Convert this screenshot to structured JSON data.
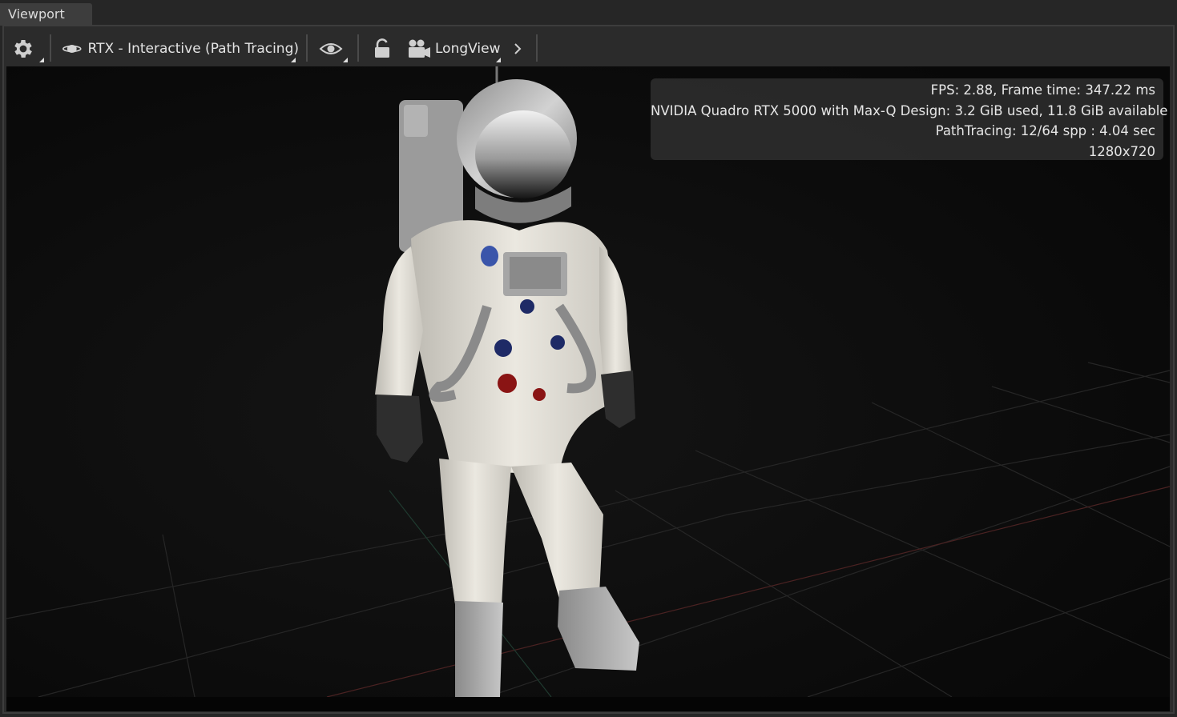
{
  "window": {
    "tab_title": "Viewport"
  },
  "toolbar": {
    "settings_icon": "gear-icon",
    "renderer_icon": "saturn-icon",
    "renderer_label": "RTX - Interactive (Path Tracing)",
    "visibility_icon": "eye-icon",
    "lock_icon": "unlock-icon",
    "camera_icon": "movie-camera-icon",
    "camera_label": "LongView",
    "expand_icon": "chevron-right-icon"
  },
  "stats": {
    "fps_line": "FPS: 2.88, Frame time: 347.22 ms",
    "gpu_line": "NVIDIA Quadro RTX 5000 with Max-Q Design: 3.2 GiB used, 11.8 GiB available",
    "pathtracing_line": "PathTracing: 12/64 spp : 4.04 sec",
    "resolution_line": "1280x720"
  },
  "scene": {
    "subject": "astronaut-model",
    "colors": {
      "background": "#0b0b0b",
      "grid": "#2a2a2a",
      "x_axis": "#5a2a2a",
      "z_axis": "#2a4a3a"
    }
  }
}
